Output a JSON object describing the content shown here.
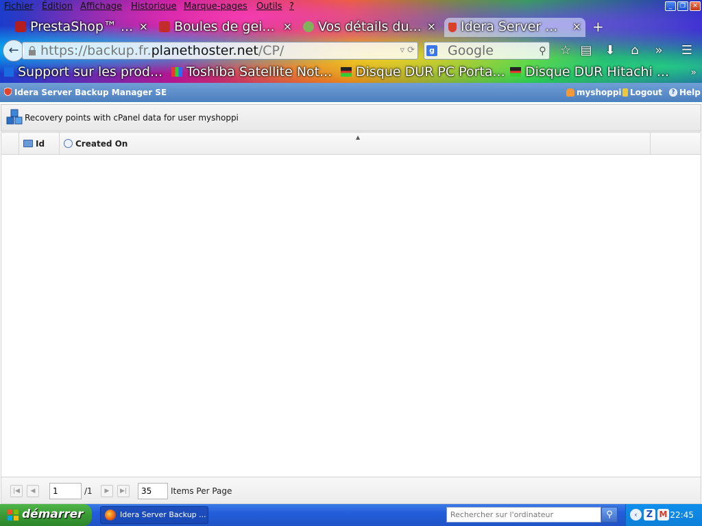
{
  "menubar": {
    "items": [
      "Fichier",
      "Édition",
      "Affichage",
      "Historique",
      "Marque-pages",
      "Outils",
      "?"
    ]
  },
  "tabs": [
    {
      "label": "PrestaShop™ ..."
    },
    {
      "label": "Boules de gei..."
    },
    {
      "label": "Vos détails du..."
    },
    {
      "label": "Idera Server ..."
    }
  ],
  "newtab_label": "+",
  "urlbar": {
    "prefix": "https://backup.fr.",
    "host": "planethoster.net",
    "path": "/CP/"
  },
  "search": {
    "placeholder": "Google"
  },
  "bookmarks": [
    {
      "label": "Support sur les prod..."
    },
    {
      "label": "Toshiba Satellite Not..."
    },
    {
      "label": "Disque DUR PC Porta..."
    },
    {
      "label": "Disque DUR Hitachi ..."
    }
  ],
  "bookmarks_more": "»",
  "app": {
    "title": "Idera Server Backup Manager SE",
    "user": "myshoppi",
    "logout": "Logout",
    "help": "Help"
  },
  "panel": {
    "title": "Recovery points with cPanel data for user myshoppi"
  },
  "grid": {
    "columns": [
      {
        "label": "Id"
      },
      {
        "label": "Created On"
      }
    ],
    "sort_indicator": "▲"
  },
  "pager": {
    "page": "1",
    "of_pages": "/1",
    "per_page": "35",
    "per_page_label": "Items Per Page"
  },
  "taskbar": {
    "start": "démarrer",
    "task_label": "Idera Server Backup ...",
    "search_placeholder": "Rechercher sur l'ordinateur",
    "clock": "22:45"
  }
}
